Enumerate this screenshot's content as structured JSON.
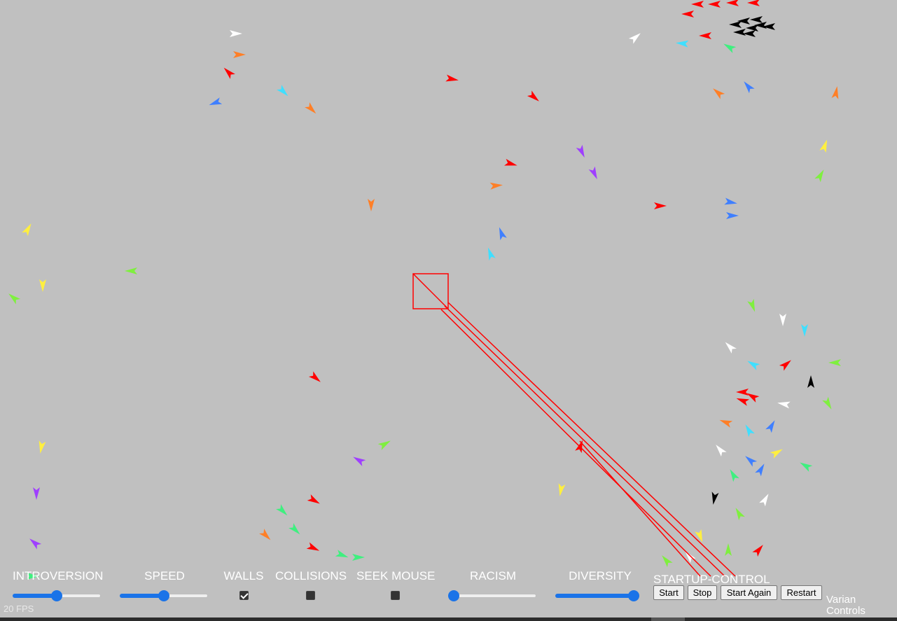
{
  "controls": {
    "introversion": {
      "label": "INTROVERSION",
      "value": 0.5
    },
    "speed": {
      "label": "SPEED",
      "value": 0.5
    },
    "walls": {
      "label": "WALLS",
      "checked": true
    },
    "collisions": {
      "label": "COLLISIONS",
      "checked": false
    },
    "seek_mouse": {
      "label": "SEEK MOUSE",
      "checked": false
    },
    "racism": {
      "label": "RACISM",
      "value": 0.0
    },
    "diversity": {
      "label": "DIVERSITY",
      "value": 1.0
    }
  },
  "startup": {
    "label": "STARTUP-CONTROL",
    "buttons": {
      "start": "Start",
      "stop": "Stop",
      "start_again": "Start Again",
      "restart": "Restart"
    }
  },
  "varian_label": "Varian Controls",
  "fps_label": "20 FPS",
  "colors": {
    "background": "#c0c0c0",
    "red": "#ff0000",
    "orange": "#ff7f27",
    "white": "#ffffff",
    "black": "#000000",
    "blue": "#3f7fff",
    "cyan": "#3fdfff",
    "purple": "#9f3fff",
    "yellow": "#ffef3f",
    "lime": "#7fef3f",
    "green": "#3fef7f",
    "accent": "#1a73e8"
  }
}
